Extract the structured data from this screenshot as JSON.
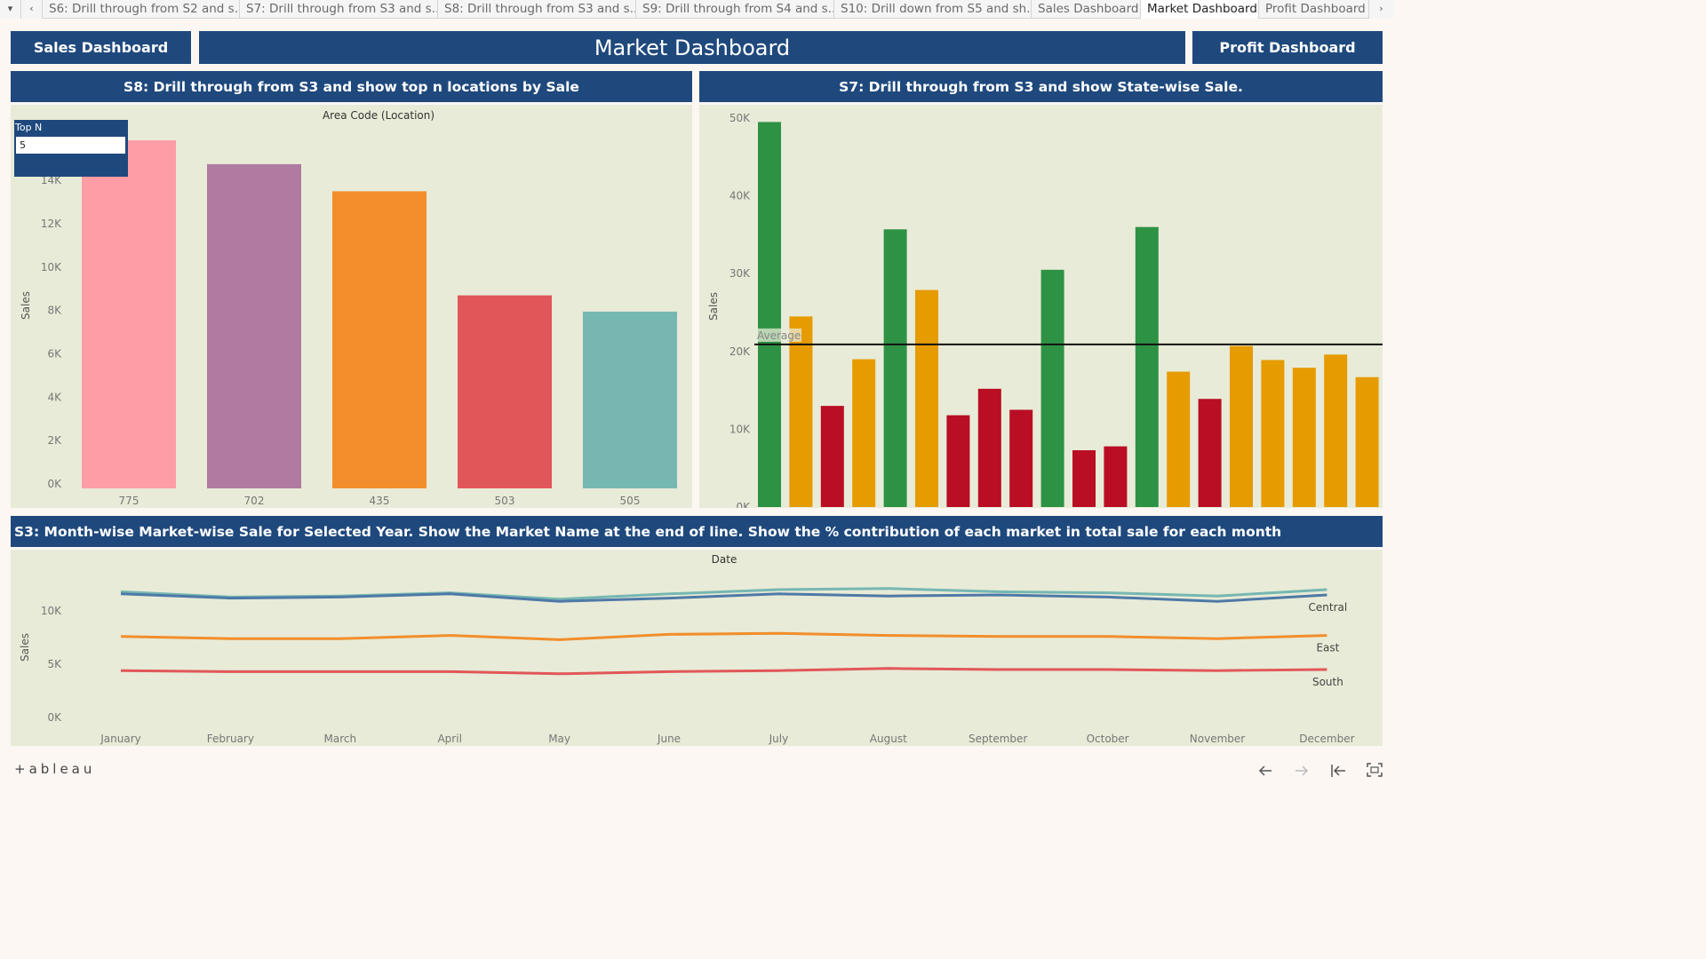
{
  "tabs": [
    {
      "label": "S6: Drill through from S2 and s...",
      "active": false
    },
    {
      "label": "S7: Drill through from S3 and s...",
      "active": false
    },
    {
      "label": "S8: Drill through from S3 and s...",
      "active": false
    },
    {
      "label": "S9: Drill through from S4 and s...",
      "active": false
    },
    {
      "label": "S10: Drill down from S5 and sh...",
      "active": false
    },
    {
      "label": "Sales Dashboard",
      "active": false
    },
    {
      "label": "Market Dashboard",
      "active": true
    },
    {
      "label": "Profit Dashboard",
      "active": false
    }
  ],
  "tab_controls": {
    "dropdown": "▾",
    "prev": "‹",
    "next": "›"
  },
  "header": {
    "sales_button": "Sales Dashboard",
    "title": "Market Dashboard",
    "profit_button": "Profit Dashboard"
  },
  "s8": {
    "title": "S8: Drill through from S3 and show top n locations by Sale",
    "topn_label": "Top N",
    "topn_value": "5"
  },
  "s7": {
    "title": "S7: Drill through from S3 and show State-wise Sale."
  },
  "s3": {
    "title": "S3: Month-wise Market-wise Sale for Selected Year. Show the Market Name at the end of line. Show the % contribution of each market in total sale for each month"
  },
  "footer": {
    "logo": "+ableau",
    "icons": [
      "back-icon",
      "forward-icon",
      "first-icon",
      "fullscreen-icon"
    ]
  },
  "colors": {
    "navy": "#1f497d",
    "plot_bg": "#e8ebd7"
  },
  "chart_data": [
    {
      "type": "bar",
      "name": "s8",
      "title": "Area Code (Location)",
      "xlabel": "Area Code (Location)",
      "ylabel": "Sales",
      "categories": [
        "775",
        "702",
        "435",
        "503",
        "505"
      ],
      "values": [
        16050,
        14950,
        13700,
        8900,
        8150
      ],
      "colors": [
        "#ff9da7",
        "#b07aa1",
        "#f28e2b",
        "#e15759",
        "#76b7b2"
      ],
      "yticks": [
        "0K",
        "2K",
        "4K",
        "6K",
        "8K",
        "10K",
        "12K",
        "14K"
      ],
      "ylim": [
        0,
        16050
      ]
    },
    {
      "type": "bar",
      "name": "s7",
      "ylabel": "Sales",
      "values": [
        49500,
        24500,
        13000,
        19000,
        35700,
        27900,
        11800,
        15200,
        12500,
        30500,
        7300,
        7800,
        36000,
        17400,
        13900,
        20700,
        18900,
        17900,
        19600,
        16700
      ],
      "colors": [
        "#2e9244",
        "#e69b00",
        "#b90e23",
        "#e69b00",
        "#2e9244",
        "#e69b00",
        "#b90e23",
        "#b90e23",
        "#b90e23",
        "#2e9244",
        "#b90e23",
        "#b90e23",
        "#2e9244",
        "#e69b00",
        "#b90e23",
        "#e69b00",
        "#e69b00",
        "#e69b00",
        "#e69b00",
        "#e69b00"
      ],
      "average": 20900,
      "average_label": "Average",
      "yticks": [
        "0K",
        "10K",
        "20K",
        "30K",
        "40K",
        "50K"
      ],
      "ylim": [
        0,
        50000
      ]
    },
    {
      "type": "line",
      "name": "s3",
      "title": "Date",
      "xlabel": "Date",
      "ylabel": "Sales",
      "x": [
        "January",
        "February",
        "March",
        "April",
        "May",
        "June",
        "July",
        "August",
        "September",
        "October",
        "November",
        "December"
      ],
      "yticks": [
        "0K",
        "5K",
        "10K"
      ],
      "ylim": [
        0,
        12000
      ],
      "series": [
        {
          "values": [
            11800,
            11300,
            11400,
            11700,
            11100,
            11600,
            12000,
            12100,
            11800,
            11700,
            11400,
            12000
          ],
          "color": "#76b7b2"
        },
        {
          "name": "Central",
          "values": [
            11600,
            11200,
            11300,
            11600,
            10900,
            11200,
            11600,
            11400,
            11500,
            11300,
            10900,
            11500
          ],
          "color": "#4e79a7"
        },
        {
          "name": "East",
          "values": [
            7600,
            7400,
            7400,
            7700,
            7300,
            7800,
            7900,
            7700,
            7600,
            7600,
            7400,
            7700
          ],
          "color": "#f28e2b"
        },
        {
          "name": "South",
          "values": [
            4400,
            4300,
            4300,
            4300,
            4100,
            4300,
            4400,
            4600,
            4500,
            4500,
            4400,
            4500
          ],
          "color": "#e15759"
        }
      ]
    }
  ]
}
